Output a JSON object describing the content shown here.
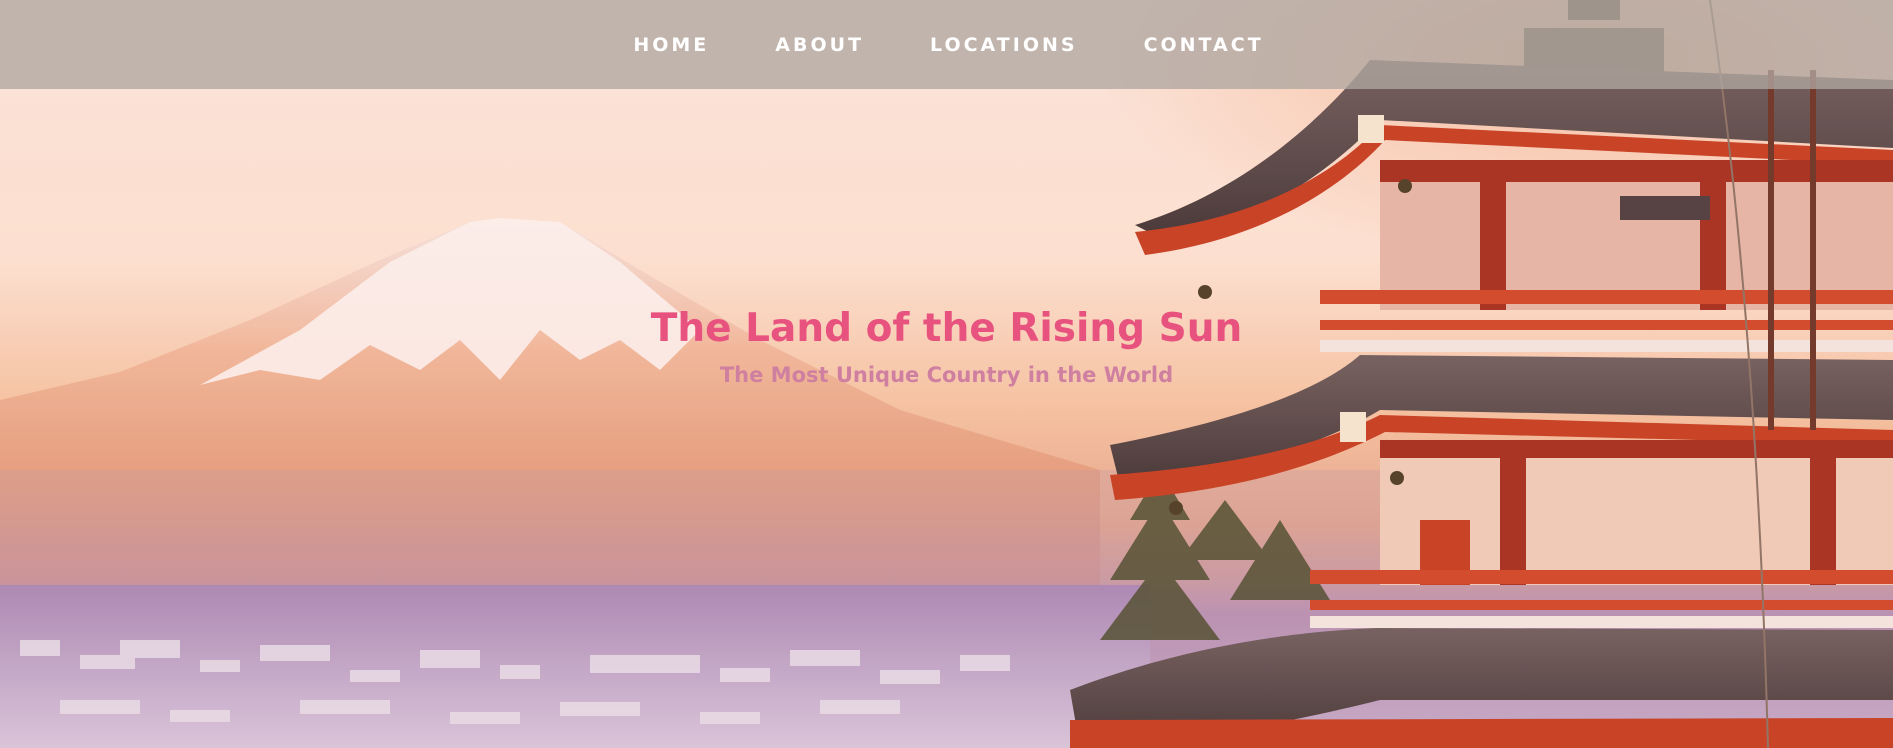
{
  "nav": {
    "items": [
      {
        "label": "HOME"
      },
      {
        "label": "ABOUT"
      },
      {
        "label": "LOCATIONS"
      },
      {
        "label": "CONTACT"
      }
    ]
  },
  "hero": {
    "title": "The Land of the Rising Sun",
    "subtitle": "The Most Unique Country in the World",
    "image": "mount-fuji-pagoda-photo"
  },
  "colors": {
    "title": "#e8527e",
    "subtitle": "#cf7fa0",
    "nav_bg": "#b0a6a0",
    "nav_text": "#ffffff"
  }
}
